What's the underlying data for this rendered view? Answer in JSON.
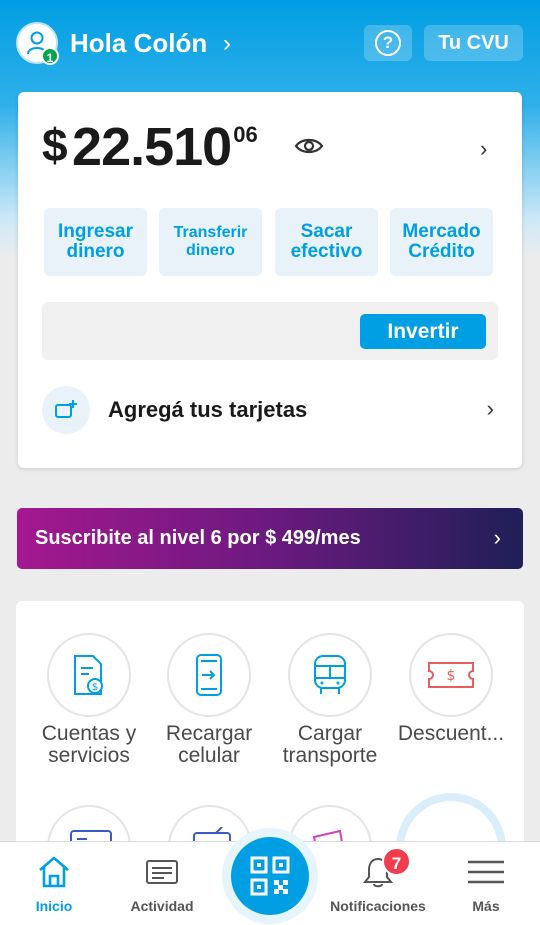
{
  "header": {
    "greeting": "Hola Colón",
    "level": "1",
    "cvu_label": "Tu CVU"
  },
  "balance": {
    "currency": "$",
    "integer": "22.510",
    "cents": "06"
  },
  "actions": [
    {
      "label": "Ingresar dinero"
    },
    {
      "label": "Transferir dinero"
    },
    {
      "label": "Sacar efectivo"
    },
    {
      "label": "Mercado Crédito"
    }
  ],
  "invest": {
    "label": "Invertir"
  },
  "add_cards": {
    "label": "Agregá tus tarjetas"
  },
  "promo": {
    "label": "Suscribite al nivel 6 por $ 499/mes"
  },
  "services": [
    {
      "label": "Cuentas y servicios",
      "icon": "bill-icon"
    },
    {
      "label": "Recargar celular",
      "icon": "phone-recharge-icon"
    },
    {
      "label": "Cargar transporte",
      "icon": "bus-icon"
    },
    {
      "label": "Descuent...",
      "icon": "coupon-icon"
    }
  ],
  "tabbar": {
    "tabs": [
      {
        "label": "Inicio",
        "icon": "home-icon",
        "active": true
      },
      {
        "label": "Actividad",
        "icon": "activity-icon",
        "active": false
      },
      {
        "label": "Notificaciones",
        "icon": "bell-icon",
        "active": false
      },
      {
        "label": "Más",
        "icon": "menu-icon",
        "active": false
      }
    ],
    "notification_count": "7"
  },
  "colors": {
    "primary": "#009ee3",
    "promo_start": "#a4188f",
    "promo_end": "#1f1f57",
    "badge": "#f23d4f"
  }
}
